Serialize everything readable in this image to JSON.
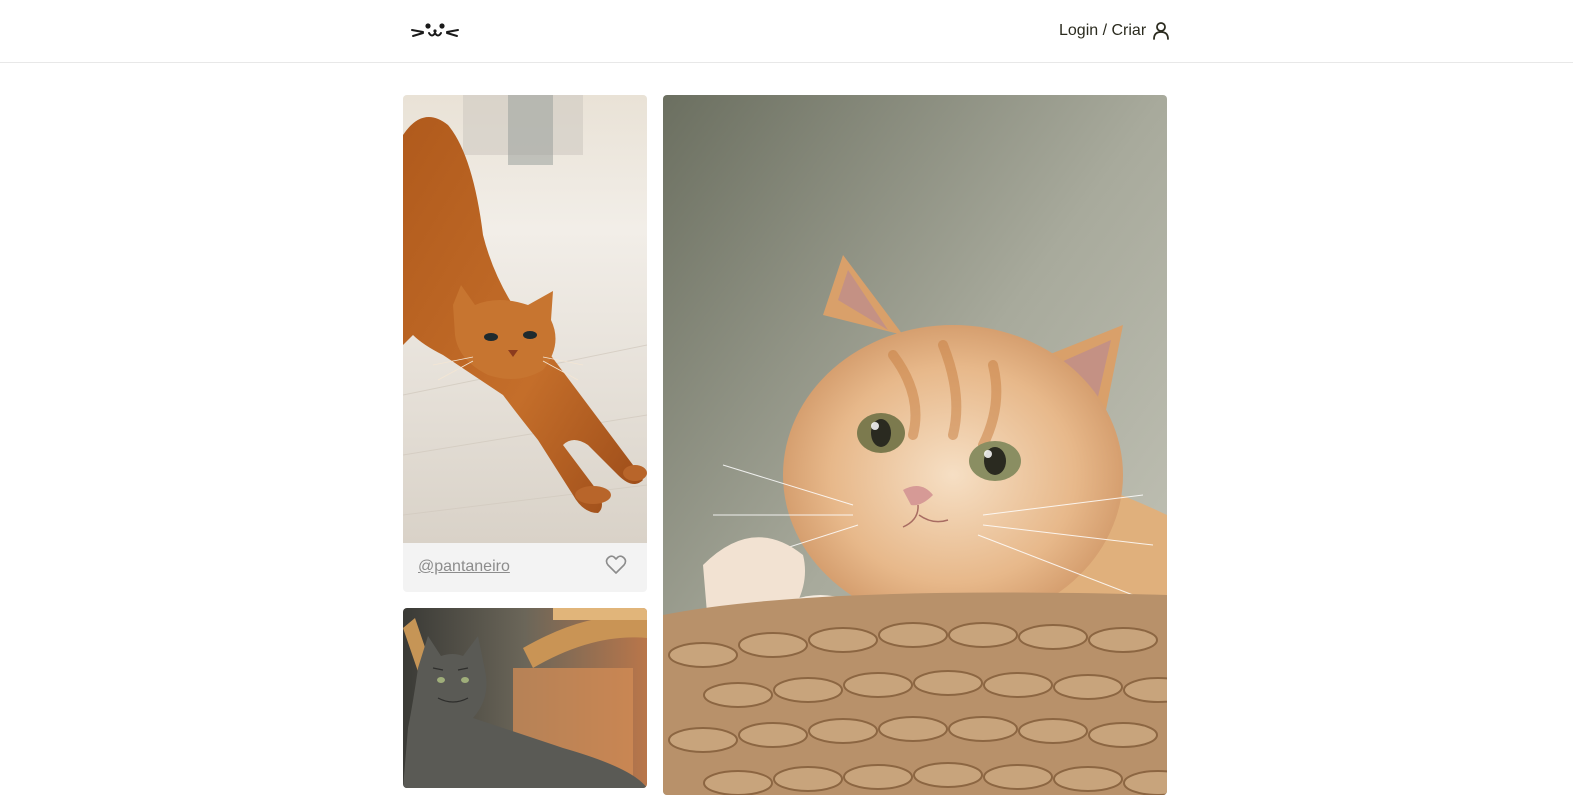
{
  "header": {
    "logo_icon": "cat-face-logo-icon",
    "login_label": "Login / Criar",
    "user_icon": "user-icon"
  },
  "feed": {
    "posts": [
      {
        "author": "@pantaneiro",
        "like_icon": "heart-outline-icon",
        "photo": "orange cat stretching on wooden floor"
      },
      {
        "photo": "grey tabby long-haired cat on wooden furniture"
      },
      {
        "photo": "ginger and white kitten resting paws on wicker basket"
      }
    ]
  },
  "colors": {
    "text_dark": "#2b2b1f",
    "author_text": "#8c8c8c",
    "card_bg": "#f3f3f3",
    "header_border": "#e8e8e8"
  }
}
